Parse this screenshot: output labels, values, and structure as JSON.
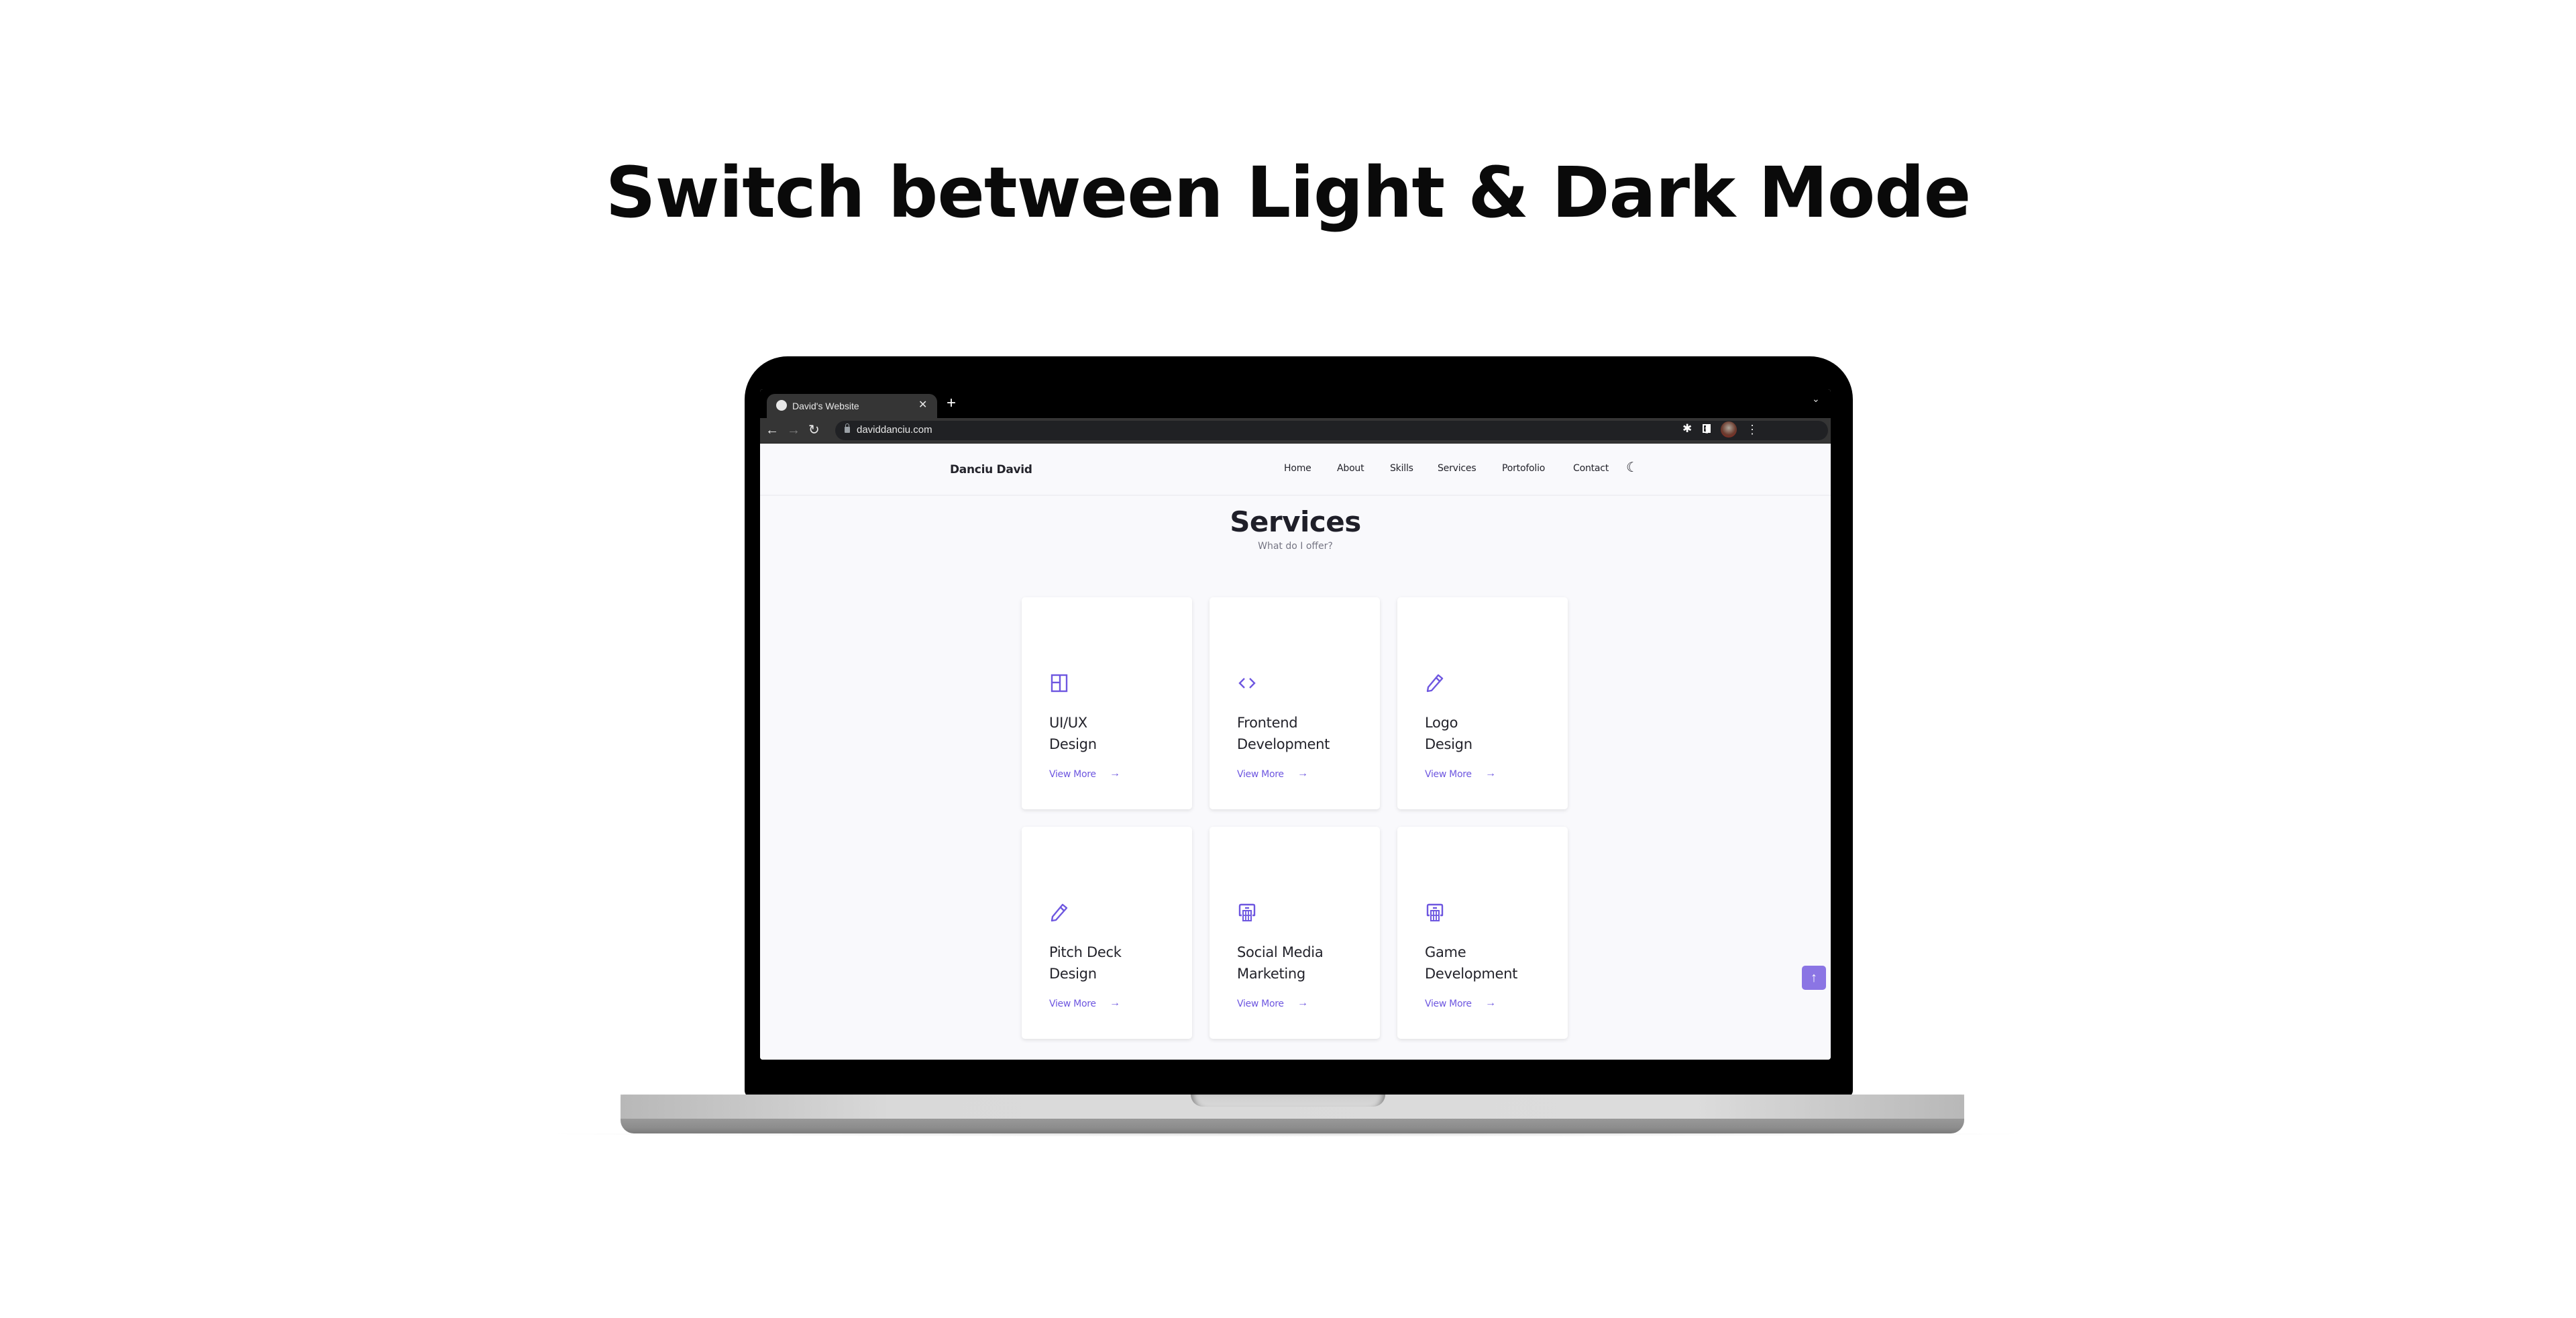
{
  "headline": "Switch between Light & Dark Mode",
  "browser": {
    "tab_title": "David's Website",
    "tab_close": "✕",
    "new_tab": "+",
    "tab_list": "⌄",
    "back": "←",
    "forward": "→",
    "reload": "↻",
    "url": "daviddanciu.com",
    "share": "⇪",
    "bookmark_star": "★",
    "extensions": "✱",
    "menu": "⋮"
  },
  "site": {
    "logo": "Danciu David",
    "nav": [
      {
        "label": "Home"
      },
      {
        "label": "About"
      },
      {
        "label": "Skills"
      },
      {
        "label": "Services"
      },
      {
        "label": "Portofolio"
      },
      {
        "label": "Contact"
      }
    ],
    "theme_toggle_icon": "☾",
    "section_title": "Services",
    "section_subtitle": "What do I offer?",
    "accent_color": "#6e57e0",
    "cards": [
      {
        "icon": "layout-icon",
        "title_line1": "UI/UX",
        "title_line2": "Design",
        "link": "View More",
        "arrow": "→"
      },
      {
        "icon": "code-icon",
        "title_line1": "Frontend",
        "title_line2": "Development",
        "link": "View More",
        "arrow": "→"
      },
      {
        "icon": "pencil-icon",
        "title_line1": "Logo",
        "title_line2": "Design",
        "link": "View More",
        "arrow": "→"
      },
      {
        "icon": "pencil-icon",
        "title_line1": "Pitch Deck",
        "title_line2": "Design",
        "link": "View More",
        "arrow": "→"
      },
      {
        "icon": "basket-icon",
        "title_line1": "Social Media",
        "title_line2": "Marketing",
        "link": "View More",
        "arrow": "→"
      },
      {
        "icon": "basket-icon",
        "title_line1": "Game",
        "title_line2": "Development",
        "link": "View More",
        "arrow": "→"
      }
    ],
    "scroll_up_icon": "↑"
  }
}
